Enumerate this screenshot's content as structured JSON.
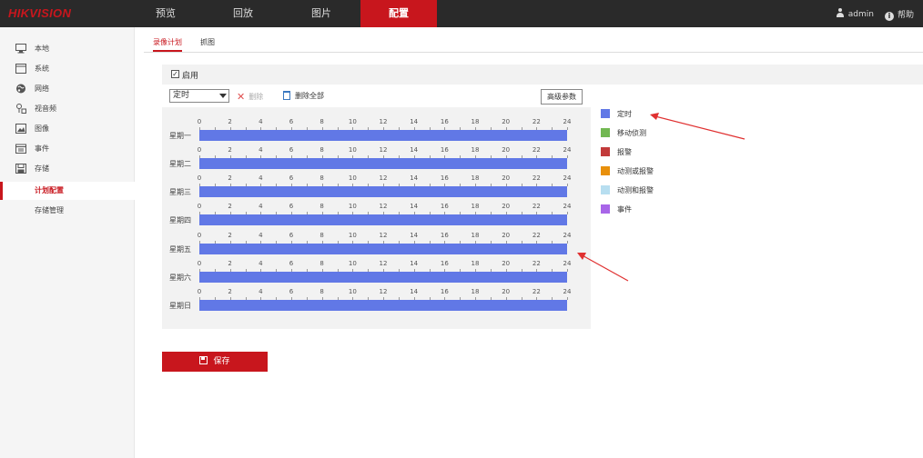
{
  "brand": "HIKVISION",
  "nav": [
    "预览",
    "回放",
    "图片",
    "配置"
  ],
  "user": {
    "name": "admin",
    "help": "帮助"
  },
  "sidebar": [
    {
      "label": "本地",
      "icon": "monitor-icon"
    },
    {
      "label": "系统",
      "icon": "system-icon"
    },
    {
      "label": "网络",
      "icon": "globe-icon"
    },
    {
      "label": "视音频",
      "icon": "audio-video-icon"
    },
    {
      "label": "图像",
      "icon": "image-icon"
    },
    {
      "label": "事件",
      "icon": "calendar-icon"
    },
    {
      "label": "存储",
      "icon": "storage-icon"
    },
    {
      "label": "计划配置",
      "icon": ""
    },
    {
      "label": "存储管理",
      "icon": ""
    }
  ],
  "tabs": [
    "录像计划",
    "抓图"
  ],
  "enable": {
    "label": "启用",
    "checked": true
  },
  "toolbar": {
    "select_value": "定时",
    "delete_label": "删除",
    "delete_all_label": "删除全部",
    "advanced_label": "高级参数"
  },
  "schedule": {
    "hour_ticks": [
      "0",
      "2",
      "4",
      "6",
      "8",
      "10",
      "12",
      "14",
      "16",
      "18",
      "20",
      "22",
      "24"
    ],
    "days": [
      {
        "label": "星期一",
        "start": 0,
        "end": 24,
        "type": "定时"
      },
      {
        "label": "星期二",
        "start": 0,
        "end": 24,
        "type": "定时"
      },
      {
        "label": "星期三",
        "start": 0,
        "end": 24,
        "type": "定时"
      },
      {
        "label": "星期四",
        "start": 0,
        "end": 24,
        "type": "定时"
      },
      {
        "label": "星期五",
        "start": 0,
        "end": 24,
        "type": "定时"
      },
      {
        "label": "星期六",
        "start": 0,
        "end": 24,
        "type": "定时"
      },
      {
        "label": "星期日",
        "start": 0,
        "end": 24,
        "type": "定时"
      }
    ]
  },
  "legend": [
    {
      "label": "定时",
      "color": "#6178e6"
    },
    {
      "label": "移动侦测",
      "color": "#72b852"
    },
    {
      "label": "报警",
      "color": "#c23a3a"
    },
    {
      "label": "动测或报警",
      "color": "#e8900c"
    },
    {
      "label": "动测和报警",
      "color": "#b7def0"
    },
    {
      "label": "事件",
      "color": "#a866e8"
    }
  ],
  "save_label": "保存",
  "colors": {
    "accent": "#c8161d",
    "topbar": "#2a2a2a",
    "schedule_fill": "#6178e6",
    "annotation": "#e03030"
  }
}
